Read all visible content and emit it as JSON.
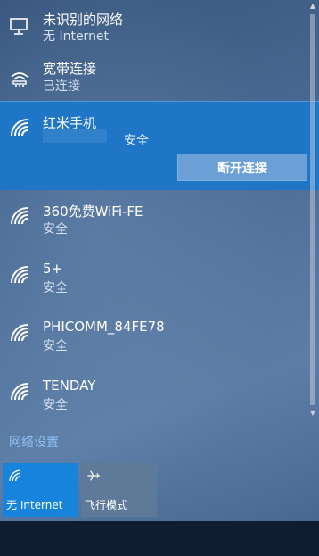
{
  "networks": [
    {
      "name": "未识别的网络",
      "status": "无 Internet",
      "icon": "monitor-icon"
    },
    {
      "name": "宽带连接",
      "status": "已连接",
      "icon": "dialup-icon"
    }
  ],
  "active": {
    "name": "红米手机",
    "security": "安全",
    "disconnect_label": "断开连接",
    "icon": "wifi-icon"
  },
  "wifi": [
    {
      "name": "360免费WiFi-FE",
      "security": "安全"
    },
    {
      "name": "5+",
      "security": "安全"
    },
    {
      "name": "PHICOMM_84FE78",
      "security": "安全"
    },
    {
      "name": "TENDAY",
      "security": "安全"
    }
  ],
  "settings_link": "网络设置",
  "tiles": [
    {
      "label": "无 Internet",
      "icon": "wifi-icon",
      "active": true
    },
    {
      "label": "飞行模式",
      "icon": "airplane-icon",
      "active": false
    }
  ],
  "colors": {
    "accent": "#1f76c6",
    "tile_active": "#1684dd",
    "link": "#8fc0f3"
  }
}
